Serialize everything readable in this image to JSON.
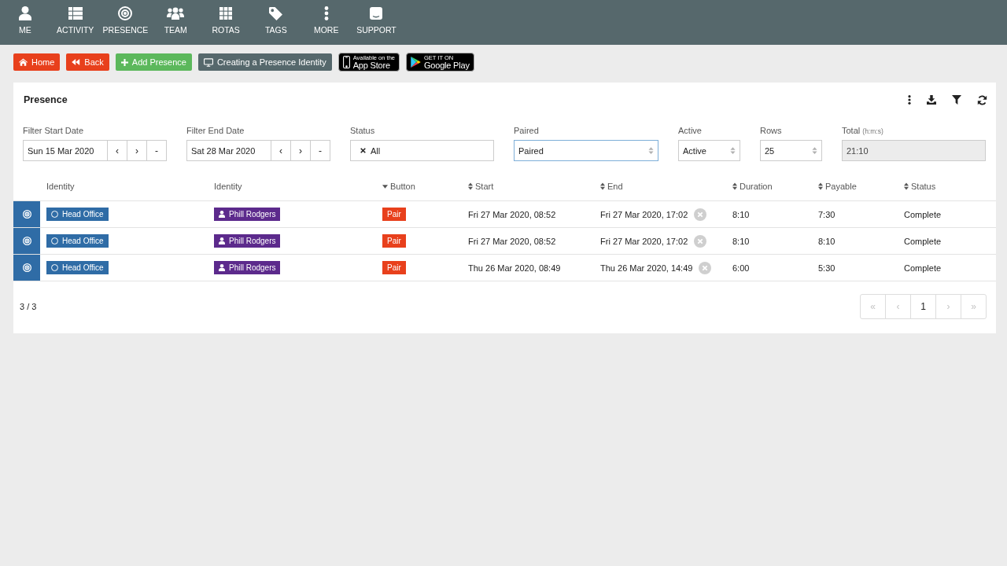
{
  "nav": {
    "items": [
      {
        "label": "ME"
      },
      {
        "label": "ACTIVITY"
      },
      {
        "label": "PRESENCE"
      },
      {
        "label": "TEAM"
      },
      {
        "label": "ROTAS"
      },
      {
        "label": "TAGS"
      },
      {
        "label": "MORE"
      },
      {
        "label": "SUPPORT"
      }
    ]
  },
  "actions": [
    {
      "label": "Home",
      "kind": "danger"
    },
    {
      "label": "Back",
      "kind": "danger"
    },
    {
      "label": "Add Presence",
      "kind": "success"
    },
    {
      "label": "Creating a Presence Identity",
      "kind": "secondary"
    }
  ],
  "store_badges": [
    {
      "small": "Available on the",
      "large": "App Store"
    },
    {
      "small": "GET IT ON",
      "large": "Google Play"
    }
  ],
  "panel": {
    "title": "Presence",
    "filters": [
      {
        "kind": "date",
        "label": "Filter Start Date",
        "value": "Sun 15 Mar 2020",
        "steps": [
          "‹",
          "›",
          "-"
        ]
      },
      {
        "kind": "date",
        "label": "Filter End Date",
        "value": "Sat 28 Mar 2020",
        "steps": [
          "‹",
          "›",
          "-"
        ]
      },
      {
        "kind": "tags",
        "label": "Status",
        "tags": [
          "All"
        ]
      },
      {
        "kind": "select",
        "label": "Paired",
        "value": "Paired",
        "focused": true
      },
      {
        "kind": "select",
        "label": "Active",
        "value": "Active",
        "focused": false
      },
      {
        "kind": "select",
        "label": "Rows",
        "value": "25",
        "focused": false
      },
      {
        "kind": "readonly",
        "label": "Total",
        "note": "(h:m:s)",
        "value": "21:10"
      }
    ],
    "table": {
      "columns": [
        {
          "label": "Identity"
        },
        {
          "label": "Identity"
        },
        {
          "label": "Button",
          "sorted": true
        },
        {
          "label": "Start",
          "sorted": false
        },
        {
          "label": "End",
          "sorted": false
        },
        {
          "label": "Duration",
          "sorted": false
        },
        {
          "label": "Payable",
          "sorted": false
        },
        {
          "label": "Status",
          "sorted": false
        }
      ],
      "rows": [
        {
          "location": "Head Office",
          "person": "Phill Rodgers",
          "button": "Pair",
          "start": "Fri 27 Mar 2020, 08:52",
          "end": "Fri 27 Mar 2020, 17:02",
          "duration": "8:10",
          "payable": "7:30",
          "status": "Complete"
        },
        {
          "location": "Head Office",
          "person": "Phill Rodgers",
          "button": "Pair",
          "start": "Fri 27 Mar 2020, 08:52",
          "end": "Fri 27 Mar 2020, 17:02",
          "duration": "8:10",
          "payable": "8:10",
          "status": "Complete"
        },
        {
          "location": "Head Office",
          "person": "Phill Rodgers",
          "button": "Pair",
          "start": "Thu 26 Mar 2020, 08:49",
          "end": "Thu 26 Mar 2020, 14:49",
          "duration": "6:00",
          "payable": "5:30",
          "status": "Complete"
        }
      ]
    },
    "count": "3 / 3",
    "pagination": [
      {
        "label": "«",
        "disabled": true
      },
      {
        "label": "‹",
        "disabled": true
      },
      {
        "label": "1",
        "disabled": false
      },
      {
        "label": "›",
        "disabled": true
      },
      {
        "label": "»",
        "disabled": true
      }
    ]
  }
}
